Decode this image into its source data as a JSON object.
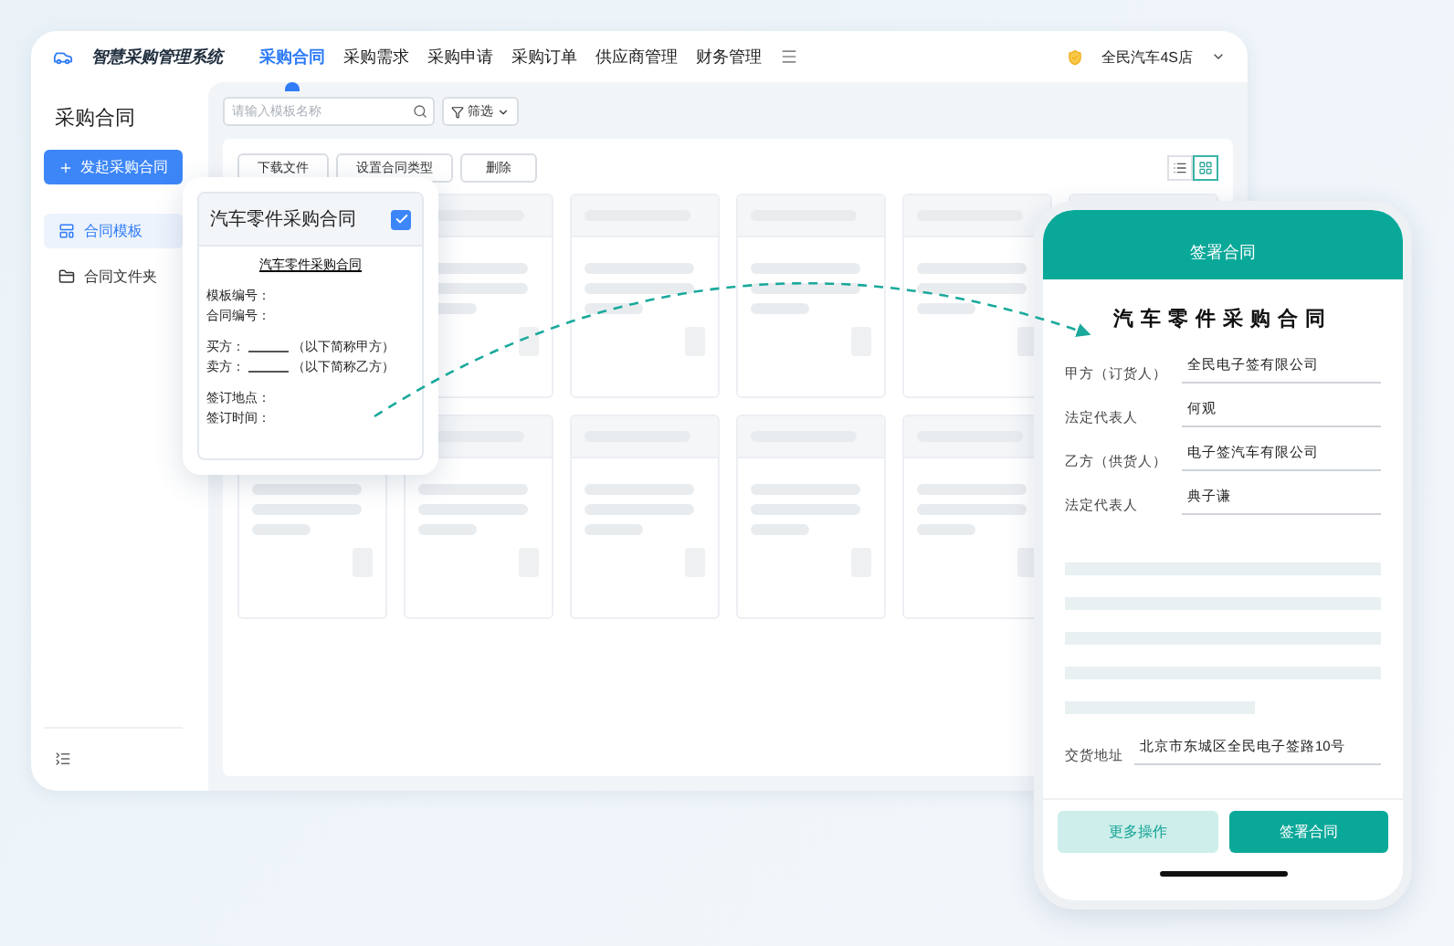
{
  "app": {
    "title": "智慧采购管理系统",
    "store": "全民汽车4S店",
    "nav": [
      {
        "label": "采购合同",
        "selected": true
      },
      {
        "label": "采购需求",
        "selected": false
      },
      {
        "label": "采购申请",
        "selected": false
      },
      {
        "label": "采购订单",
        "selected": false
      },
      {
        "label": "供应商管理",
        "selected": false
      },
      {
        "label": "财务管理",
        "selected": false
      }
    ]
  },
  "sidebar": {
    "title": "采购合同",
    "new_button": "发起采购合同",
    "items": [
      {
        "label": "合同模板",
        "selected": true
      },
      {
        "label": "合同文件夹",
        "selected": false
      }
    ]
  },
  "toolbar": {
    "search": {
      "placeholder": "请输入模板名称"
    },
    "filter": "筛选",
    "actions": [
      "下载文件",
      "设置合同类型",
      "删除"
    ],
    "views": [
      {
        "kind": "list",
        "selected": false
      },
      {
        "kind": "grid",
        "selected": true
      }
    ]
  },
  "template_card": {
    "title": "汽车零件采购合同",
    "checked": true,
    "doc_title": "汽车零件采购合同",
    "doc_sections": [
      [
        {
          "label": "模板编号："
        },
        {
          "label": "合同编号："
        }
      ],
      [
        {
          "label": "买方：",
          "note": "（以下简称甲方）"
        },
        {
          "label": "卖方：",
          "note": "（以下简称乙方）"
        }
      ],
      [
        {
          "label": "签订地点："
        },
        {
          "label": "签订时间："
        }
      ]
    ]
  },
  "phone": {
    "header": "签署合同",
    "title": "汽车零件采购合同",
    "fields": [
      {
        "label": "甲方（订货人）",
        "value": "全民电子签有限公司"
      },
      {
        "label": "法定代表人",
        "value": "何观"
      },
      {
        "label": "乙方（供货人）",
        "value": "电子签汽车有限公司"
      },
      {
        "label": "法定代表人",
        "value": "典子谦"
      }
    ],
    "address": {
      "label": "交货地址",
      "value": "北京市东城区全民电子签路10号"
    },
    "buttons": [
      {
        "kind": "secondary",
        "label": "更多操作"
      },
      {
        "kind": "primary",
        "label": "签署合同"
      }
    ]
  }
}
